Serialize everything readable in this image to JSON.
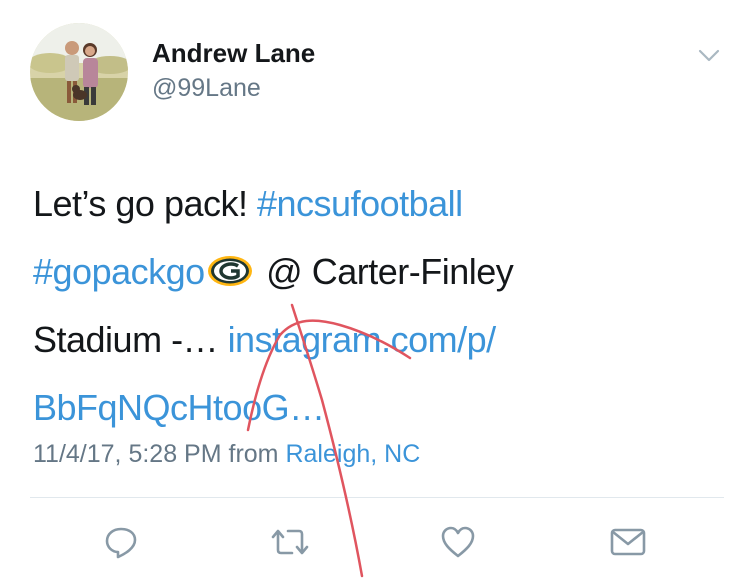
{
  "user": {
    "display_name": "Andrew Lane",
    "handle": "@99Lane"
  },
  "tweet": {
    "line1_text": "Let’s go pack! ",
    "hashtag1": "#ncsufootball",
    "hashtag2": "#gopackgo",
    "line2_text": " @ Carter-Finley",
    "line3_text": "Stadium -… ",
    "link_part1": "instagram.com/p/",
    "link_part2": "BbFqNQcHtooG…",
    "emoji": "green-bay-packers-logo"
  },
  "meta": {
    "timestamp": "11/4/17, 5:28 PM",
    "from_label": " from ",
    "location": "Raleigh, NC"
  },
  "actions": {
    "icons": [
      "reply-icon",
      "retweet-icon",
      "like-icon",
      "direct-message-icon"
    ]
  },
  "colors": {
    "link": "#3b94d9",
    "text": "#14171a",
    "secondary": "#657786",
    "annotation": "#e0555f"
  }
}
